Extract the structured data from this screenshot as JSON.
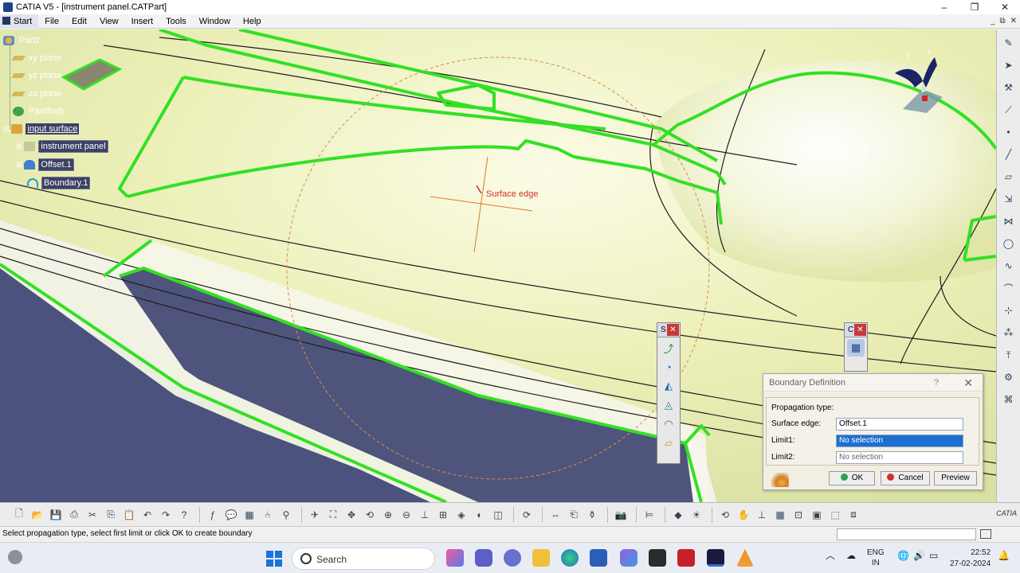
{
  "window": {
    "title": "CATIA V5 - [instrument panel.CATPart]",
    "controls": [
      "–",
      "❐",
      "✕"
    ]
  },
  "menu": {
    "items": [
      "Start",
      "File",
      "Edit",
      "View",
      "Insert",
      "Tools",
      "Window",
      "Help"
    ],
    "doc_controls": [
      "_",
      "⧉",
      "✕"
    ]
  },
  "tree": {
    "root": "Part2",
    "items": [
      "xy plane",
      "yz plane",
      "zx plane",
      "PartBody",
      "input surface",
      "instrument panel",
      "Offset.1",
      "Boundary.1"
    ]
  },
  "viewport": {
    "annotation": "Surface edge"
  },
  "mini_toolbar_left": {
    "title": "S",
    "close": "✕"
  },
  "mini_toolbar_right": {
    "title": "C",
    "close": "✕"
  },
  "dialog": {
    "title": "Boundary Definition",
    "help": "?",
    "close": "✕",
    "propagation_label": "Propagation type:",
    "surface_edge_label": "Surface edge:",
    "surface_edge_value": "Offset.1",
    "limit1_label": "Limit1:",
    "limit1_value": "No selection",
    "limit2_label": "Limit2:",
    "limit2_value": "No selection",
    "ok": "OK",
    "cancel": "Cancel",
    "preview": "Preview"
  },
  "statusbar": {
    "message": "Select propagation type, select first limit or click OK to create boundary"
  },
  "taskbar": {
    "search": "Search",
    "lang_top": "ENG",
    "lang_bottom": "IN",
    "time": "22:52",
    "date": "27-02-2024"
  },
  "brand": "CATIA"
}
